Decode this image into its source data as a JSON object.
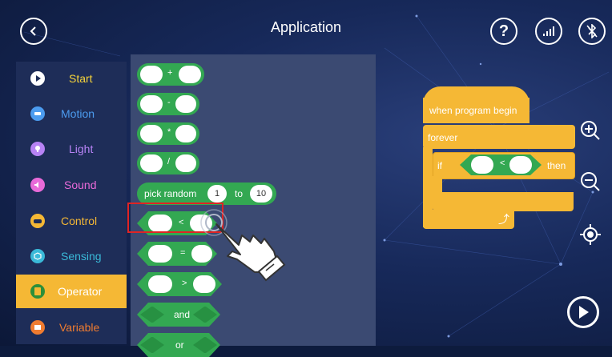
{
  "header": {
    "title": "Application"
  },
  "categories": [
    {
      "label": "Start",
      "color": "#f5d33a",
      "icon": "flag-icon"
    },
    {
      "label": "Motion",
      "color": "#4c9cf0",
      "icon": "car-icon"
    },
    {
      "label": "Light",
      "color": "#b783f5",
      "icon": "bulb-icon"
    },
    {
      "label": "Sound",
      "color": "#e86ad8",
      "icon": "speaker-icon"
    },
    {
      "label": "Control",
      "color": "#f5b835",
      "icon": "gamepad-icon"
    },
    {
      "label": "Sensing",
      "color": "#3ab9d8",
      "icon": "cube-icon"
    },
    {
      "label": "Operator",
      "color": "#2e8f3a",
      "icon": "calculator-icon"
    },
    {
      "label": "Variable",
      "color": "#f07c30",
      "icon": "grid-icon"
    }
  ],
  "palette": {
    "ops": [
      "+",
      "-",
      "*",
      "/"
    ],
    "random": {
      "label": "pick random",
      "from": "1",
      "to_label": "to",
      "to": "10"
    },
    "compare": [
      "<",
      "=",
      ">"
    ],
    "logic": [
      "and",
      "or"
    ]
  },
  "script": {
    "hat": "when program begin",
    "loop": "forever",
    "if_label": "if",
    "cond_op": "<",
    "then_label": "then"
  },
  "colors": {
    "block_green": "#33a852",
    "block_yellow": "#f5b835",
    "highlight": "#e02424"
  }
}
